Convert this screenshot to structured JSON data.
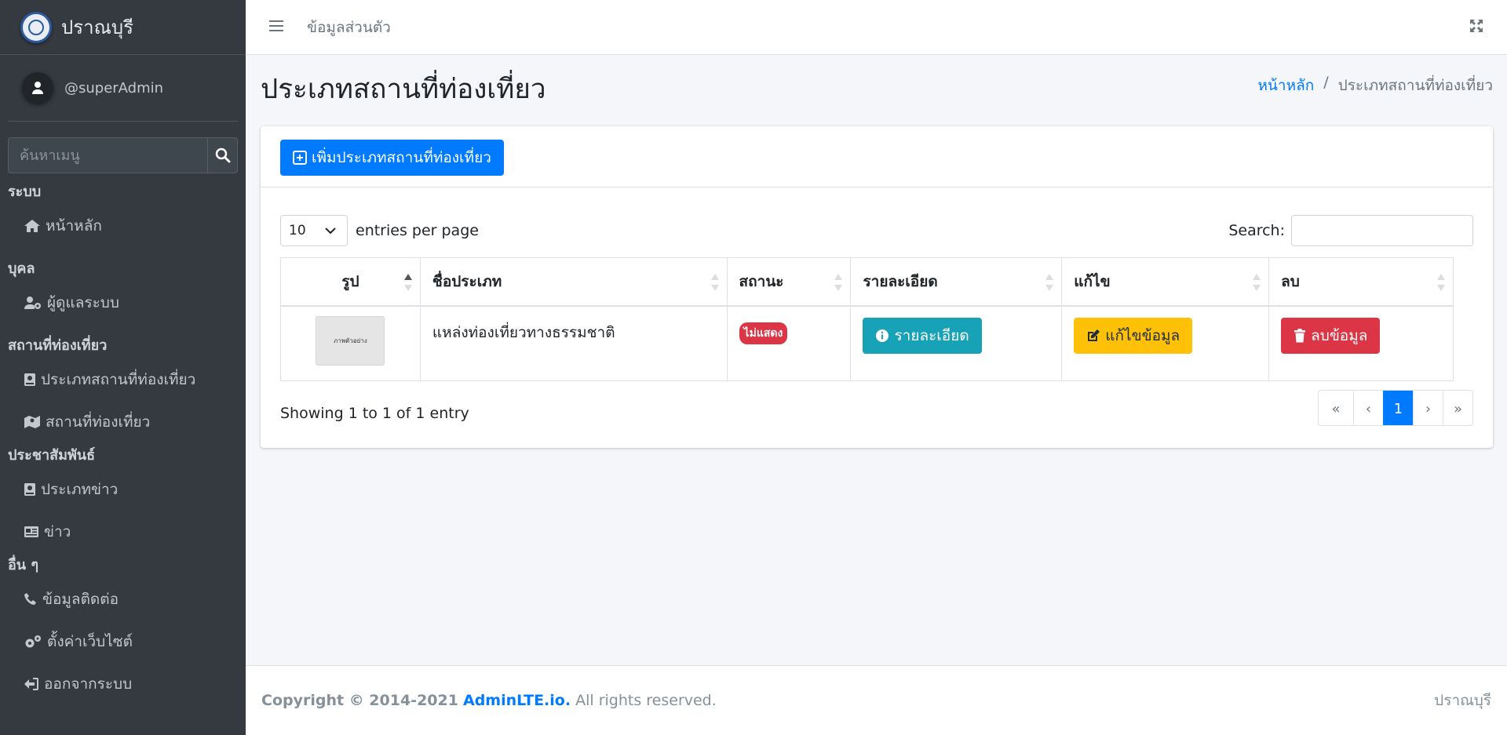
{
  "brand": {
    "name": "ปราณบุรี"
  },
  "user": {
    "name": "@superAdmin"
  },
  "sidebar": {
    "search_placeholder": "ค้นหาเมนู",
    "sections": [
      {
        "header": "ระบบ",
        "items": [
          {
            "label": "หน้าหลัก",
            "icon": "home-icon"
          }
        ]
      },
      {
        "header": "บุคล",
        "items": [
          {
            "label": "ผู้ดูแลระบบ",
            "icon": "user-cog-icon"
          }
        ]
      },
      {
        "header": "สถานที่ท่องเที่ยว",
        "items": [
          {
            "label": "ประเภทสถานที่ท่องเที่ยว",
            "icon": "book-icon"
          },
          {
            "label": "สถานที่ท่องเที่ยว",
            "icon": "map-icon"
          }
        ]
      },
      {
        "header": "ประชาสัมพันธ์",
        "items": [
          {
            "label": "ประเภทข่าว",
            "icon": "book-icon"
          },
          {
            "label": "ข่าว",
            "icon": "newspaper-icon"
          }
        ]
      },
      {
        "header": "อื่น ๆ",
        "items": [
          {
            "label": "ข้อมูลติดต่อ",
            "icon": "phone-icon"
          },
          {
            "label": "ตั้งค่าเว็บไซต์",
            "icon": "cogs-icon"
          },
          {
            "label": "ออกจากระบบ",
            "icon": "sign-out-icon"
          }
        ]
      }
    ]
  },
  "topbar": {
    "link": "ข้อมูลส่วนตัว"
  },
  "header": {
    "title": "ประเภทสถานที่ท่องเที่ยว",
    "breadcrumb_home": "หน้าหลัก",
    "breadcrumb_sep": "/",
    "breadcrumb_current": "ประเภทสถานที่ท่องเที่ยว"
  },
  "card": {
    "add_button": "เพิ่มประเภทสถานที่ท่องเที่ยว"
  },
  "datatable": {
    "per_page_value": "10",
    "per_page_label": "entries per page",
    "search_label": "Search:",
    "columns": [
      "รูป",
      "ชื่อประเภท",
      "สถานะ",
      "รายละเอียด",
      "แก้ไข",
      "ลบ"
    ],
    "rows": [
      {
        "thumb_text": "ภาพตัวอย่าง",
        "name": "แหล่งท่องเที่ยวทางธรรมชาติ",
        "status": "ไม่แสดง",
        "detail_btn": "รายละเอียด",
        "edit_btn": "แก้ไขข้อมูล",
        "delete_btn": "ลบข้อมูล"
      }
    ],
    "showing": "Showing 1 to 1 of 1 entry",
    "pagination": [
      "«",
      "‹",
      "1",
      "›",
      "»"
    ],
    "current_page": "1"
  },
  "footer": {
    "copyright": "Copyright © 2014-2021",
    "link": "AdminLTE.io.",
    "rest": "All rights reserved.",
    "right": "ปราณบุรี"
  },
  "colors": {
    "primary": "#007bff",
    "info": "#17a2b8",
    "warning": "#ffc107",
    "danger": "#dc3545",
    "sidebar": "#343a40"
  }
}
